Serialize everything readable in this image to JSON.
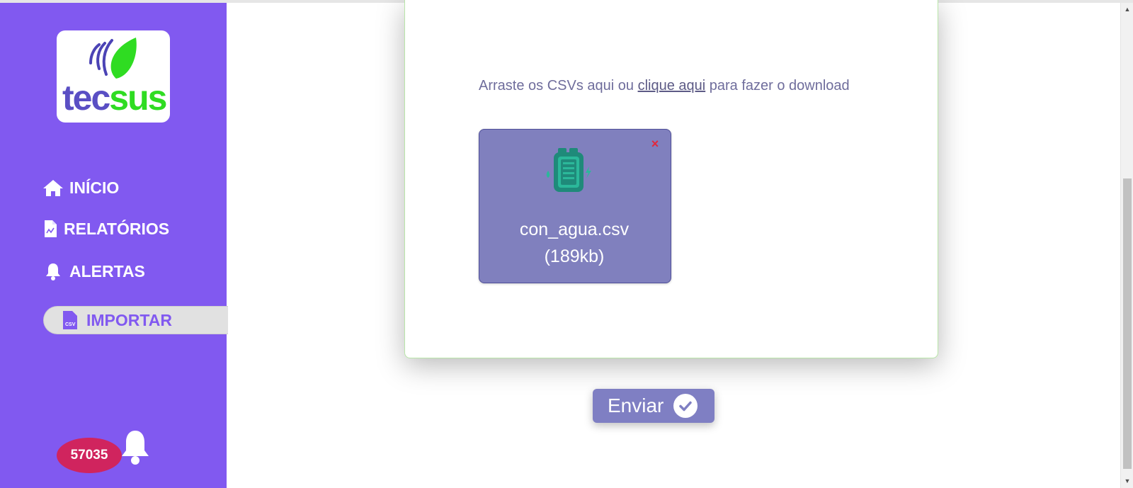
{
  "sidebar": {
    "logo": {
      "text_tec": "tec",
      "text_sus": "sus"
    },
    "nav": [
      {
        "label": "INÍCIO",
        "icon": "home-icon"
      },
      {
        "label": "RELATÓRIOS",
        "icon": "report-file-icon"
      },
      {
        "label": "ALERTAS",
        "icon": "bell-icon"
      },
      {
        "label": "IMPORTAR",
        "icon": "csv-file-icon",
        "active": true
      }
    ],
    "notifications": {
      "count": "57035",
      "icon": "bell-icon"
    }
  },
  "upload": {
    "instruction_before": "Arraste os CSVs aqui ou ",
    "instruction_link": "clique aqui",
    "instruction_after": " para fazer o download",
    "file": {
      "name": "con_agua.csv",
      "size": "(189kb)",
      "remove_symbol": "×",
      "icon": "water-meter-icon"
    },
    "submit_label": "Enviar",
    "submit_icon": "check-circle-icon"
  },
  "colors": {
    "sidebar": "#8159f0",
    "badge": "#d0245e",
    "file_tile": "#8080be",
    "submit": "#7f7fc3",
    "logo_purple": "#5a4fc4",
    "logo_green": "#2fdc22"
  }
}
